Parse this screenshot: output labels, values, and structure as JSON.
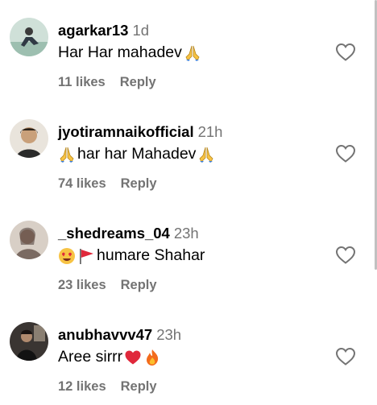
{
  "comments": [
    {
      "username": "agarkar13",
      "time": "1d",
      "text_before": "Har Har mahadev ",
      "text_after": "",
      "emojis_before": [],
      "emojis_after": [
        "folded-hands-emoji"
      ],
      "likes": "11 likes",
      "reply": "Reply"
    },
    {
      "username": "jyotiramnaikofficial",
      "time": "21h",
      "text_before": "",
      "text_after": "har har Mahadev ",
      "emojis_before": [
        "folded-hands-emoji"
      ],
      "emojis_after": [
        "folded-hands-emoji"
      ],
      "likes": "74 likes",
      "reply": "Reply"
    },
    {
      "username": "_shedreams_04",
      "time": "23h",
      "text_before": "",
      "text_after": "humare Shahar",
      "emojis_before": [
        "heart-eyes-emoji",
        "red-flag-emoji"
      ],
      "emojis_after": [],
      "likes": "23 likes",
      "reply": "Reply"
    },
    {
      "username": "anubhavvv47",
      "time": "23h",
      "text_before": "Aree sirrr ",
      "text_after": "",
      "emojis_before": [],
      "emojis_after": [
        "red-heart-emoji",
        "fire-emoji"
      ],
      "likes": "12 likes",
      "reply": "Reply"
    }
  ],
  "colors": {
    "username": "#000000",
    "secondary": "#737373",
    "background": "#ffffff"
  }
}
